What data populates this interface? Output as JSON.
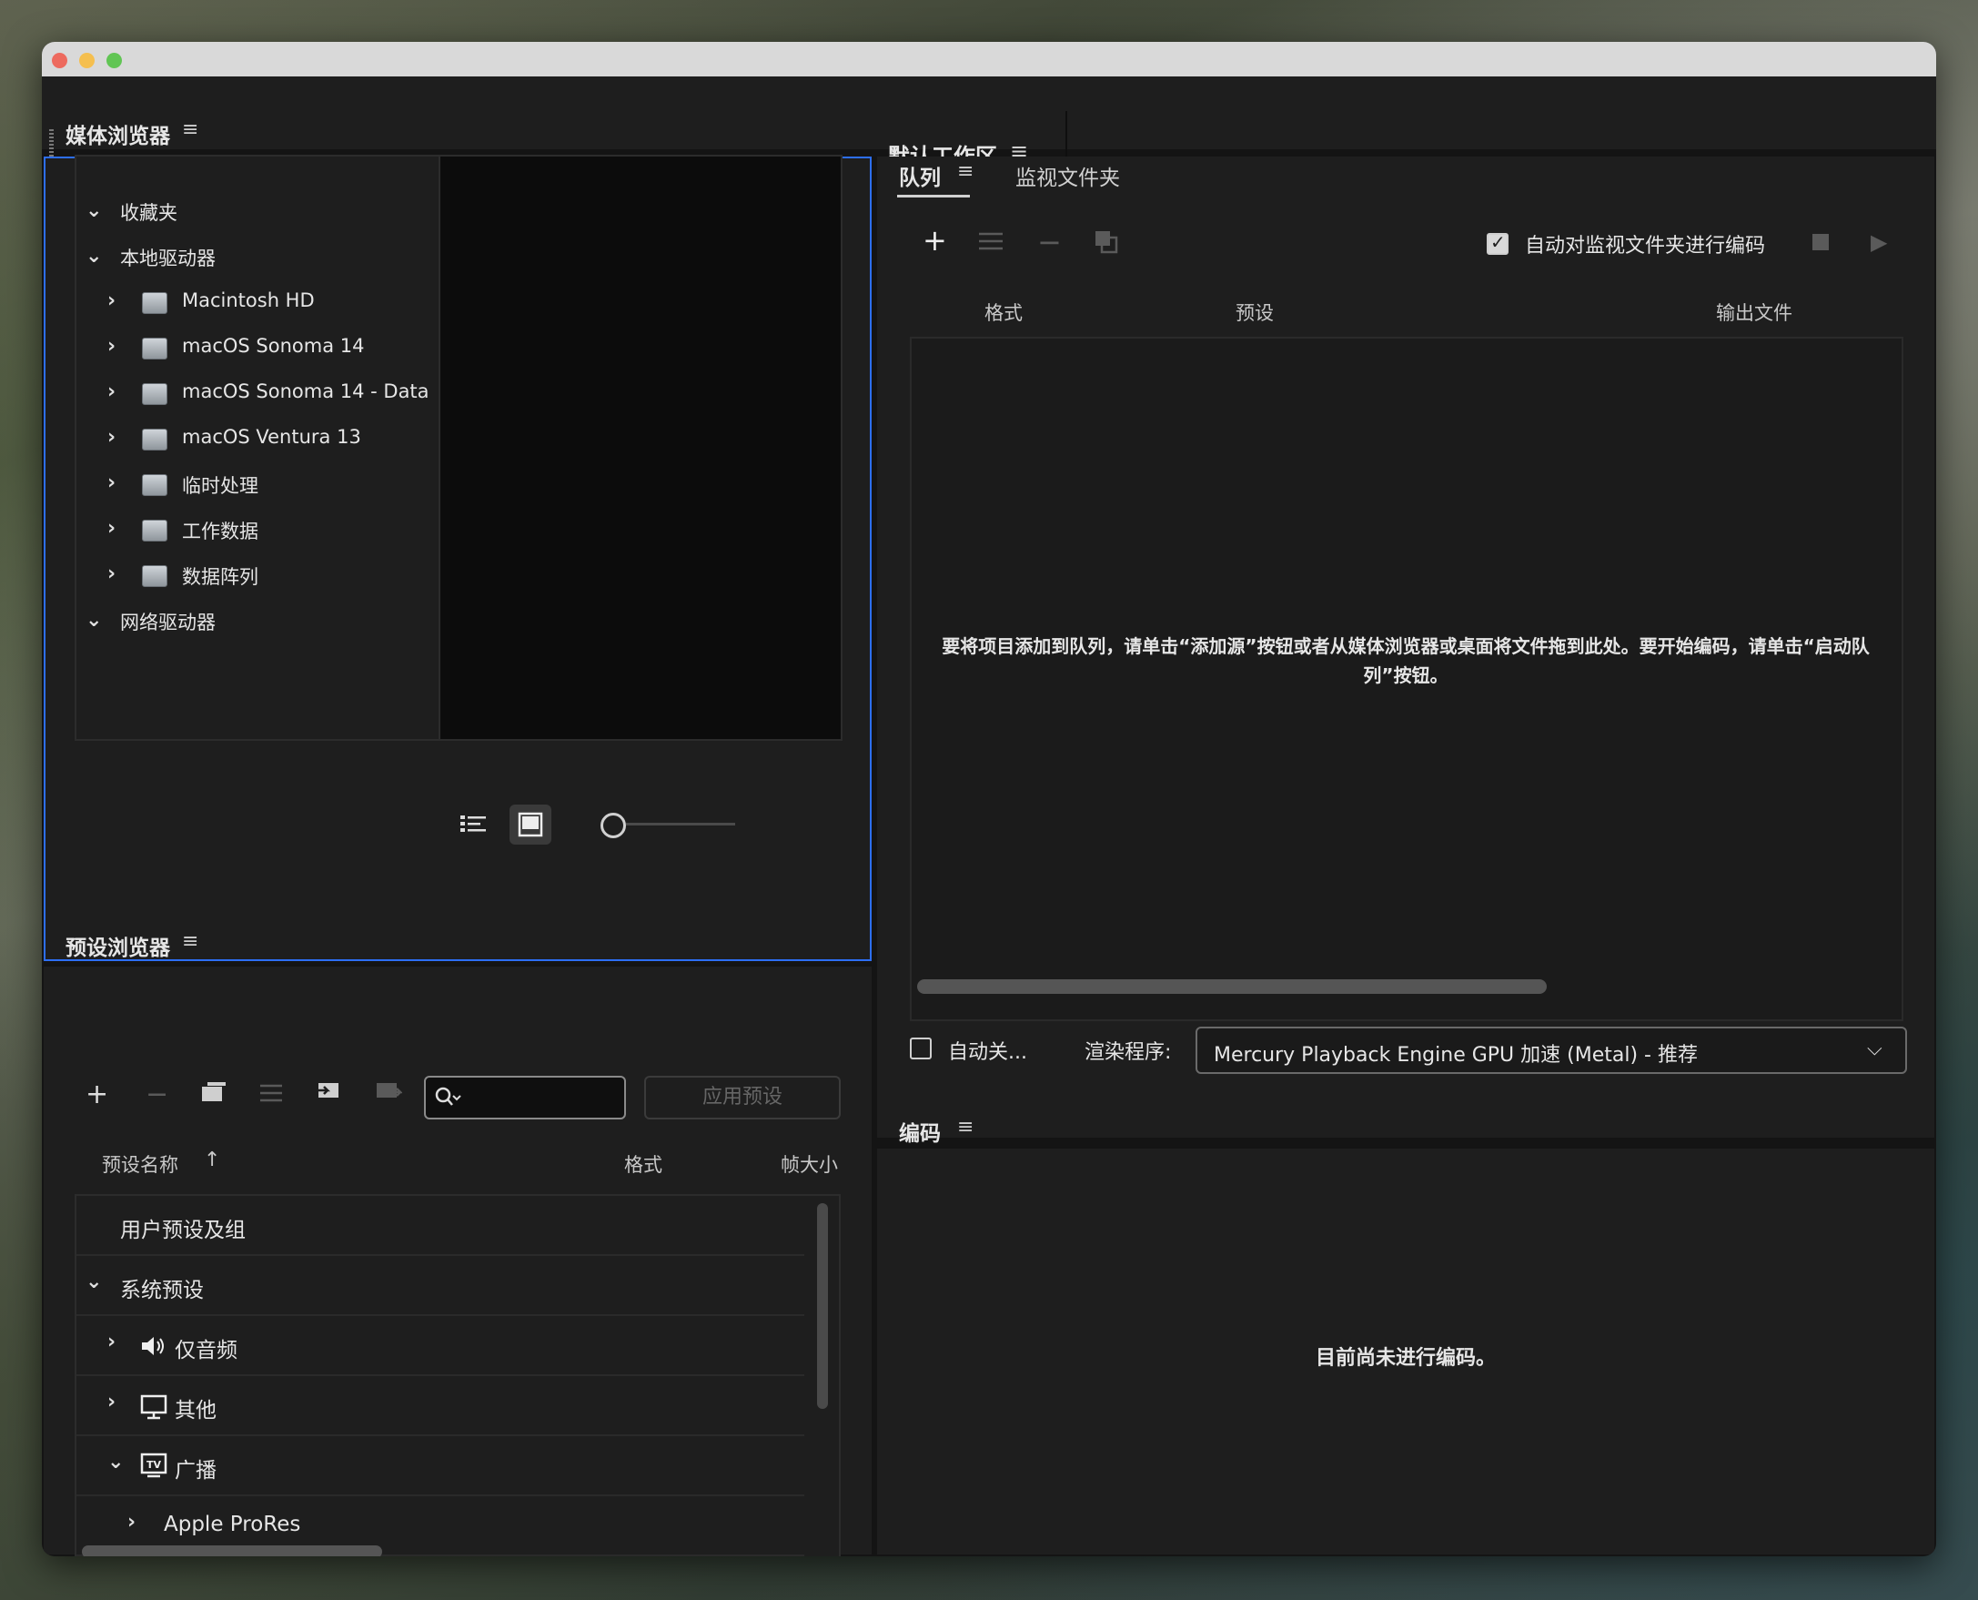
{
  "workspace": {
    "title": "默认工作区"
  },
  "media_browser": {
    "title": "媒体浏览器",
    "tree": [
      {
        "label": "收藏夹",
        "expanded": true
      },
      {
        "label": "本地驱动器",
        "expanded": true
      },
      {
        "label": "Macintosh HD",
        "icon": "drive-icon"
      },
      {
        "label": "macOS Sonoma 14",
        "icon": "drive-icon"
      },
      {
        "label": "macOS Sonoma 14 - Data",
        "icon": "drive-icon"
      },
      {
        "label": "macOS Ventura 13",
        "icon": "drive-icon"
      },
      {
        "label": "临时处理",
        "icon": "drive-icon"
      },
      {
        "label": "工作数据",
        "icon": "drive-icon"
      },
      {
        "label": "数据阵列",
        "icon": "drive-icon"
      },
      {
        "label": "网络驱动器",
        "expanded": true
      }
    ]
  },
  "preset_browser": {
    "title": "预设浏览器",
    "apply_label": "应用预设",
    "columns": {
      "name": "预设名称",
      "format": "格式",
      "frame_size": "帧大小"
    },
    "rows": [
      {
        "label": "用户预设及组"
      },
      {
        "label": "系统预设",
        "expanded": true
      },
      {
        "label": "仅音频",
        "icon": "speaker-icon"
      },
      {
        "label": "其他",
        "icon": "monitor-icon"
      },
      {
        "label": "广播",
        "icon": "tv-icon",
        "expanded": true
      },
      {
        "label": "Apple ProRes"
      }
    ]
  },
  "queue": {
    "tab_queue": "队列",
    "tab_watch": "监视文件夹",
    "auto_encode_label": "自动对监视文件夹进行编码",
    "auto_encode_checked": true,
    "columns": {
      "format": "格式",
      "preset": "预设",
      "output": "输出文件"
    },
    "empty_message": "要将项目添加到队列，请单击“添加源”按钮或者从媒体浏览器或桌面将文件拖到此处。要开始编码，请单击“启动队列”按钮。",
    "auto_close_label": "自动关...",
    "auto_close_checked": false,
    "renderer_label": "渲染程序:",
    "renderer_value": "Mercury Playback Engine GPU 加速 (Metal) - 推荐"
  },
  "encoding": {
    "title": "编码",
    "status": "目前尚未进行编码。"
  },
  "colors": {
    "accent": "#2d6ff7",
    "panel_bg": "#1e1e1e",
    "text": "#e6e6e6"
  }
}
